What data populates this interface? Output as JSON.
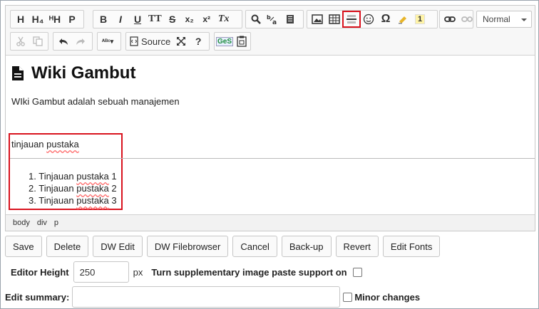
{
  "toolbar": {
    "row1": {
      "headings": [
        "H",
        "H₄",
        "ᴴH",
        "P"
      ],
      "format": [
        "B",
        "I",
        "U",
        "TT",
        "S",
        "x₂",
        "x²",
        "Tx"
      ],
      "paragraph_style": "Normal"
    },
    "row2": {
      "source_label": "Source",
      "help_label": "?",
      "ges_label": "GeS"
    }
  },
  "content": {
    "title": "Wiki Gambut",
    "paragraph": "WIki Gambut adalah sebuah manajemen",
    "section_label_part1": "tinjauan",
    "section_label_part2": "pustaka",
    "list": [
      {
        "num": "1.",
        "w1": "Tinjauan",
        "w2": "pustaka",
        "n": "1"
      },
      {
        "num": "2.",
        "w1": "Tinjauan",
        "w2": "pustaka",
        "n": "2"
      },
      {
        "num": "3.",
        "w1": "Tinjauan",
        "w2": "pustaka",
        "n": "3"
      }
    ]
  },
  "pathbar": [
    "body",
    "div",
    "p"
  ],
  "buttons": [
    "Save",
    "Delete",
    "DW Edit",
    "DW Filebrowser",
    "Cancel",
    "Back-up",
    "Revert",
    "Edit Fonts"
  ],
  "editor_height": {
    "label": "Editor Height",
    "value": "250",
    "unit": "px",
    "paste_support_label": "Turn supplementary image paste support on"
  },
  "summary": {
    "label": "Edit summary:",
    "value": "",
    "minor_label": "Minor changes"
  },
  "colors": {
    "highlight": "#d9131e",
    "spell_underline": "#ff6a6a"
  }
}
